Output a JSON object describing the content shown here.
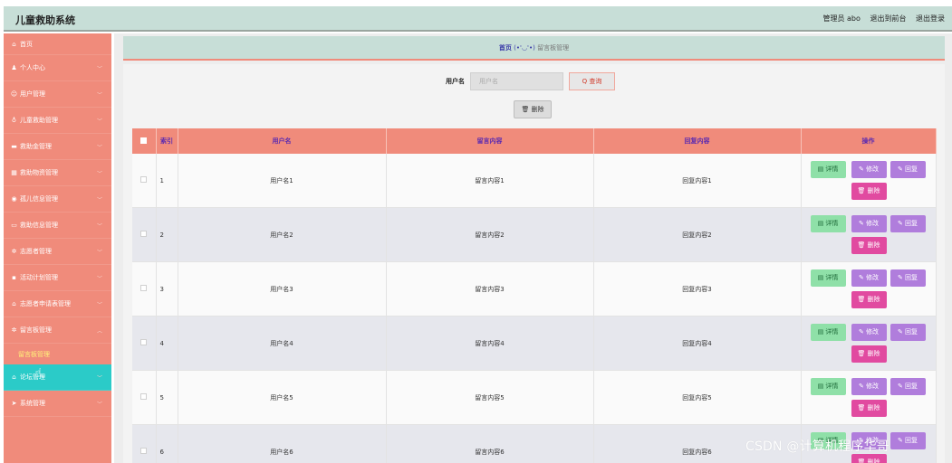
{
  "app": {
    "title": "儿童救助系统"
  },
  "header": {
    "admin_label": "管理员 abo",
    "to_front": "退出到前台",
    "logout": "退出登录"
  },
  "sidebar": {
    "items": [
      {
        "icon": "home-icon",
        "glyph": "⌂",
        "label": "首页",
        "chevron": false
      },
      {
        "icon": "user-icon",
        "glyph": "♟",
        "label": "个人中心",
        "chevron": true
      },
      {
        "icon": "user-circle-icon",
        "glyph": "☺",
        "label": "用户管理",
        "chevron": true
      },
      {
        "icon": "shield-icon",
        "glyph": "♁",
        "label": "儿童救助管理",
        "chevron": true
      },
      {
        "icon": "card-icon",
        "glyph": "▬",
        "label": "救助金管理",
        "chevron": true
      },
      {
        "icon": "grid-icon",
        "glyph": "▦",
        "label": "救助物资管理",
        "chevron": true
      },
      {
        "icon": "location-icon",
        "glyph": "◉",
        "label": "孤儿信息管理",
        "chevron": true
      },
      {
        "icon": "chat-icon",
        "glyph": "▭",
        "label": "救助信息管理",
        "chevron": true
      },
      {
        "icon": "gear-icon",
        "glyph": "✲",
        "label": "志愿者管理",
        "chevron": true
      },
      {
        "icon": "doc-icon",
        "glyph": "▪",
        "label": "活动计划管理",
        "chevron": true
      },
      {
        "icon": "bank-icon",
        "glyph": "⌂",
        "label": "志愿者申请表管理",
        "chevron": true
      },
      {
        "icon": "message-icon",
        "glyph": "✲",
        "label": "留言板管理",
        "chevron": true,
        "expanded": true
      }
    ],
    "sub_item": "留言板管理",
    "active_item": {
      "icon": "forum-icon",
      "glyph": "⌂",
      "label": "论坛管理"
    },
    "last_item": {
      "icon": "send-icon",
      "glyph": "➤",
      "label": "系统管理"
    }
  },
  "breadcrumb": {
    "home": "首页",
    "face": "(•'◡'•)",
    "current": "留言板管理"
  },
  "search": {
    "label": "用户名",
    "placeholder": "用户名",
    "button": "查询",
    "search_glyph": "Q"
  },
  "delete_button": "删除",
  "table": {
    "columns": {
      "index": "索引",
      "username": "用户名",
      "message": "留言内容",
      "reply": "回复内容",
      "actions": "操作"
    },
    "actions": {
      "detail": "详情",
      "edit": "修改",
      "reply": "回复",
      "delete": "删除"
    },
    "rows": [
      {
        "index": "1",
        "username": "用户名1",
        "message": "留言内容1",
        "reply": "回复内容1"
      },
      {
        "index": "2",
        "username": "用户名2",
        "message": "留言内容2",
        "reply": "回复内容2"
      },
      {
        "index": "3",
        "username": "用户名3",
        "message": "留言内容3",
        "reply": "回复内容3"
      },
      {
        "index": "4",
        "username": "用户名4",
        "message": "留言内容4",
        "reply": "回复内容4"
      },
      {
        "index": "5",
        "username": "用户名5",
        "message": "留言内容5",
        "reply": "回复内容5"
      },
      {
        "index": "6",
        "username": "用户名6",
        "message": "留言内容6",
        "reply": "回复内容6"
      }
    ]
  },
  "watermark": "CSDN @计算机程序华哥"
}
